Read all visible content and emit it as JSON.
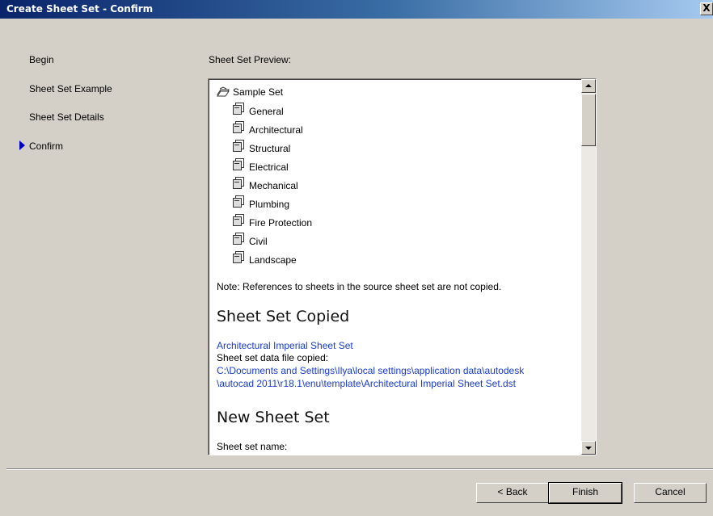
{
  "window": {
    "title": "Create Sheet Set - Confirm",
    "close_label": "X"
  },
  "nav": {
    "items": [
      {
        "label": "Begin"
      },
      {
        "label": "Sheet Set Example"
      },
      {
        "label": "Sheet Set Details"
      },
      {
        "label": "Confirm",
        "current": true
      }
    ]
  },
  "preview": {
    "label": "Sheet Set Preview:",
    "root": "Sample Set",
    "subsets": [
      "General",
      "Architectural",
      "Structural",
      "Electrical",
      "Mechanical",
      "Plumbing",
      "Fire Protection",
      "Civil",
      "Landscape"
    ],
    "note": "Note: References to sheets in the source sheet set are not copied.",
    "copied_heading": "Sheet Set Copied",
    "copied_name": "Architectural Imperial Sheet Set",
    "data_file_label": "Sheet set data file copied:",
    "data_file_path_1": "C:\\Documents and Settings\\Ilya\\local settings\\application data\\autodesk",
    "data_file_path_2": "\\autocad 2011\\r18.1\\enu\\template\\Architectural Imperial Sheet Set.dst",
    "new_heading": "New Sheet Set",
    "sheet_set_name_label": "Sheet set name:"
  },
  "buttons": {
    "back": "< Back",
    "finish": "Finish",
    "cancel": "Cancel"
  },
  "colors": {
    "link": "#1a3bd1",
    "title_bar": "#0a246a",
    "dialog_bg": "#d4d0c8",
    "nav_arrow": "#0000c0"
  }
}
